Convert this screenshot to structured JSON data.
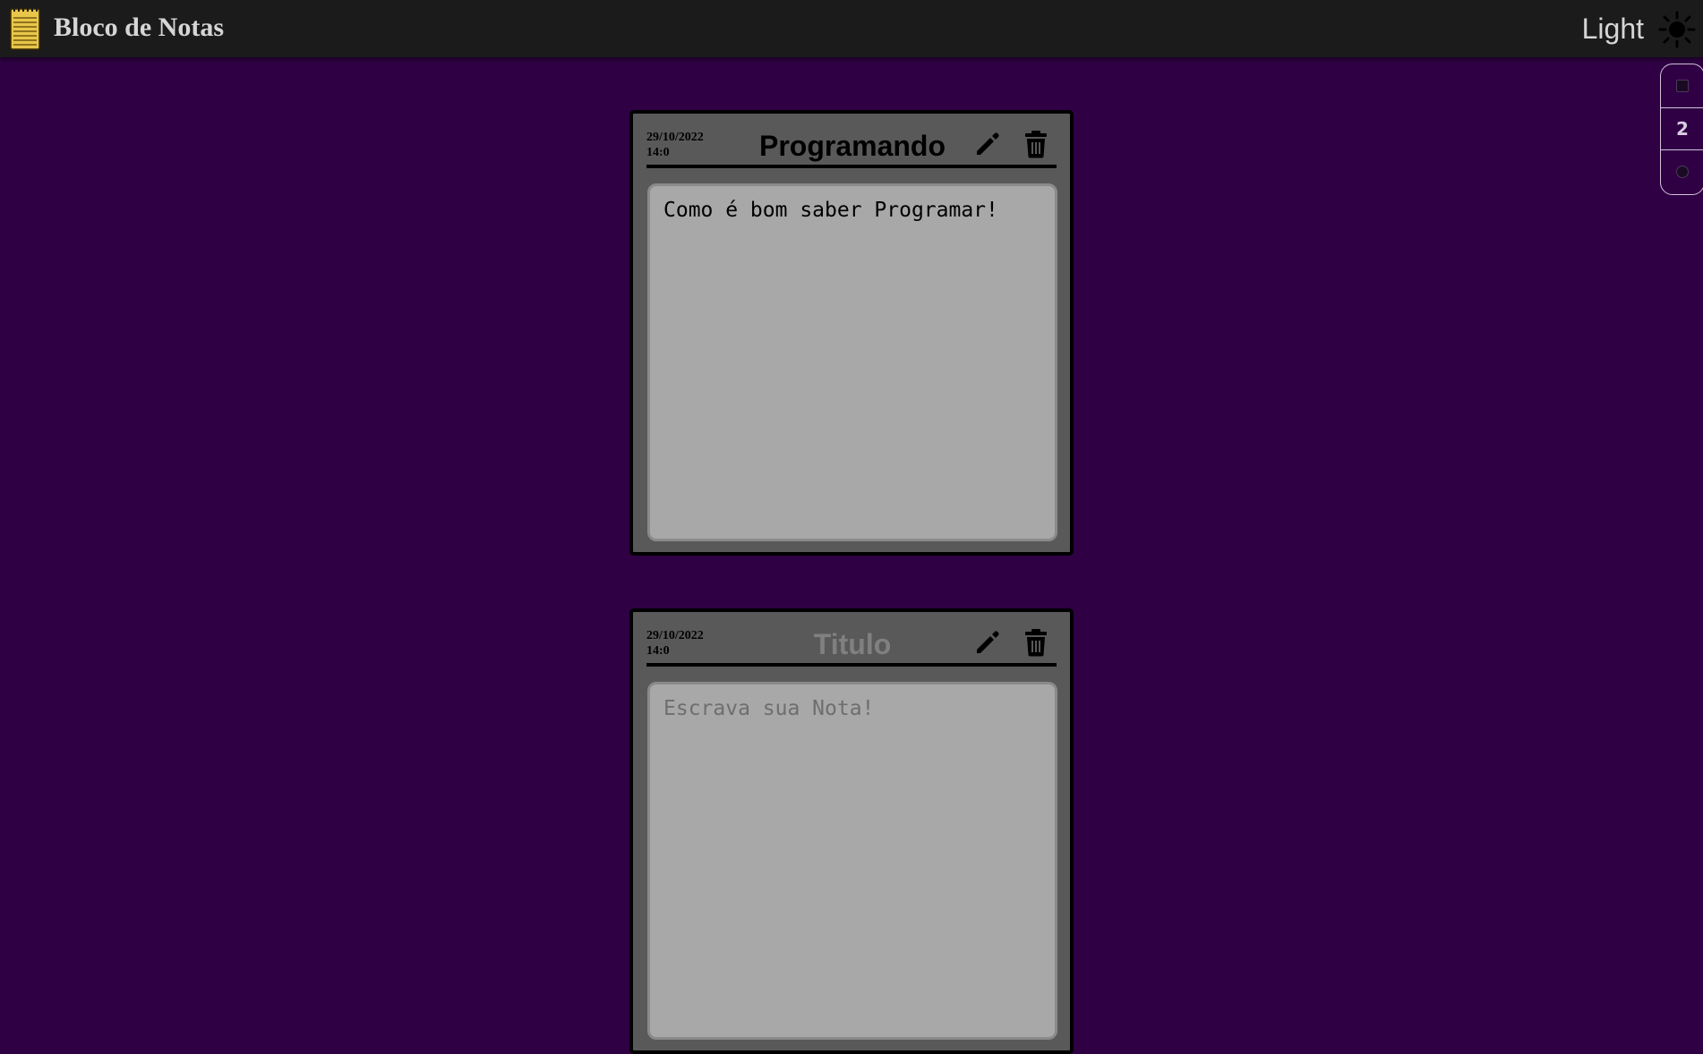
{
  "header": {
    "app_title": "Bloco de Notas",
    "logo_icon": "notepad-icon",
    "theme_label": "Light",
    "theme_icon": "sun-icon"
  },
  "pager": {
    "current_page": "2",
    "prev_icon": "square-icon",
    "next_icon": "circle-icon"
  },
  "notes": [
    {
      "date": "29/10/2022",
      "time": "14:0",
      "title": "Programando",
      "body": "Como é bom saber Programar!"
    },
    {
      "date": "29/10/2022",
      "time": "14:0",
      "title_placeholder": "Titulo",
      "body_placeholder": "Escrava sua Nota!"
    }
  ],
  "colors": {
    "background": "#300045",
    "topbar": "#1b1b1b",
    "note_frame": "#595959",
    "note_body": "#a8a8a8",
    "logo": "#e8c64a"
  }
}
